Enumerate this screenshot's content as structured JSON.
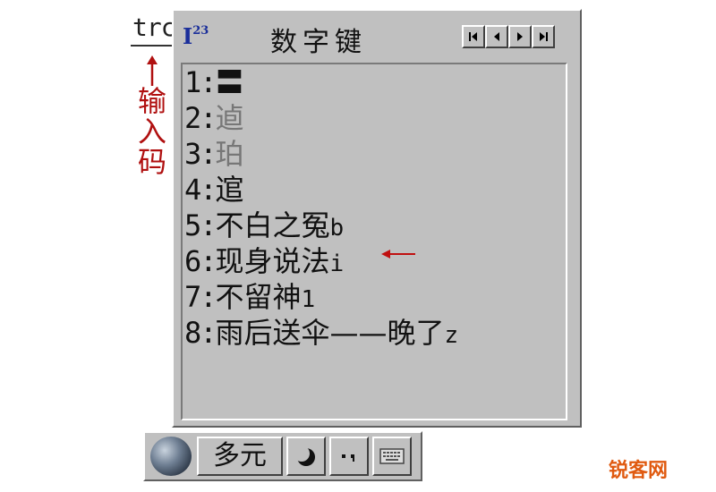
{
  "annotation": {
    "input_code": "trc",
    "label_chars": [
      "输",
      "入",
      "码"
    ]
  },
  "window": {
    "mode_icon_main": "I",
    "mode_icon_sup": "23",
    "title": "数字键",
    "page_buttons": [
      "first-page-icon",
      "prev-page-icon",
      "next-page-icon",
      "last-page-icon"
    ]
  },
  "candidates": [
    {
      "num": "1:",
      "text": "〓",
      "suffix": "",
      "faded": false
    },
    {
      "num": "2:",
      "text": "逌",
      "suffix": "",
      "faded": true
    },
    {
      "num": "3:",
      "text": "珀",
      "suffix": "",
      "faded": true
    },
    {
      "num": "4:",
      "text": "逭",
      "suffix": "",
      "faded": false
    },
    {
      "num": "5:",
      "text": "不白之冤",
      "suffix": "b",
      "faded": false
    },
    {
      "num": "6:",
      "text": "现身说法",
      "suffix": "i",
      "faded": false
    },
    {
      "num": "7:",
      "text": "不留神",
      "suffix": "1",
      "faded": false
    },
    {
      "num": "8:",
      "text": "雨后送伞——晚了",
      "suffix": "z",
      "faded": false
    }
  ],
  "status_bar": {
    "mode_label": "多元",
    "icons": [
      "globe-icon",
      "half-moon-icon",
      "punctuation-icon",
      "soft-keyboard-icon"
    ]
  },
  "watermark": "锐客网",
  "colors": {
    "window_bg": "#c0c0c0",
    "annotation_red": "#b01010",
    "icon_blue": "#1a2e9a",
    "watermark_orange": "#e05a10"
  }
}
